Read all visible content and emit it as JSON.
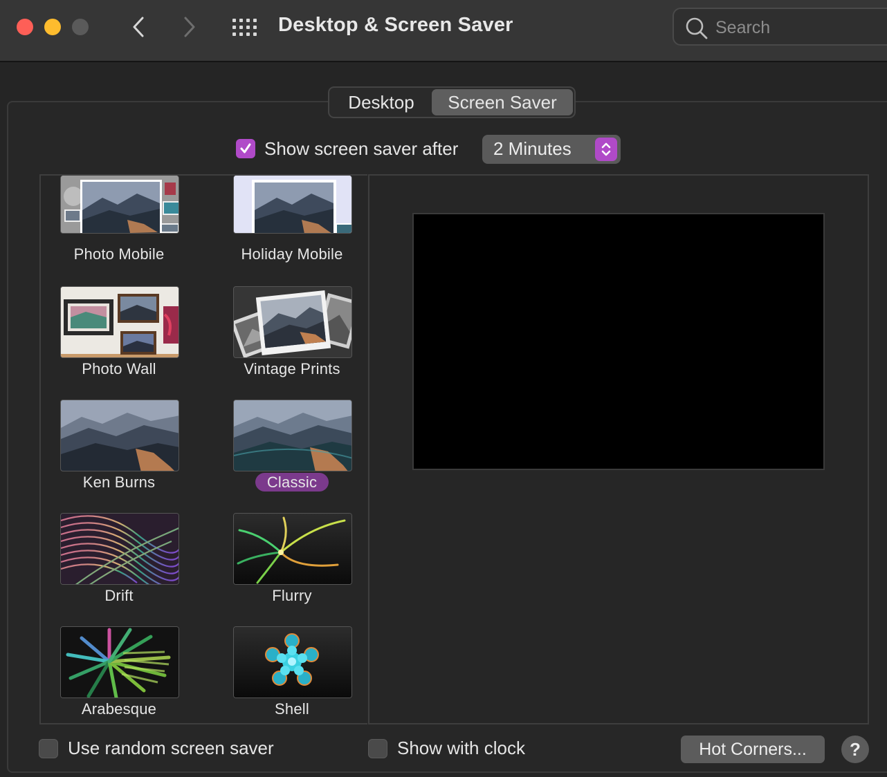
{
  "window": {
    "title": "Desktop & Screen Saver",
    "search_placeholder": "Search"
  },
  "tabs": [
    {
      "label": "Desktop",
      "active": false
    },
    {
      "label": "Screen Saver",
      "active": true
    }
  ],
  "show_after": {
    "label": "Show screen saver after",
    "checked": true,
    "value": "2 Minutes"
  },
  "savers": [
    {
      "name": "Photo Mobile",
      "selected": false
    },
    {
      "name": "Holiday Mobile",
      "selected": false
    },
    {
      "name": "Photo Wall",
      "selected": false
    },
    {
      "name": "Vintage Prints",
      "selected": false
    },
    {
      "name": "Ken Burns",
      "selected": false
    },
    {
      "name": "Classic",
      "selected": true
    },
    {
      "name": "Drift",
      "selected": false
    },
    {
      "name": "Flurry",
      "selected": false
    },
    {
      "name": "Arabesque",
      "selected": false
    },
    {
      "name": "Shell",
      "selected": false
    }
  ],
  "bottom": {
    "random_label": "Use random screen saver",
    "random_checked": false,
    "clock_label": "Show with clock",
    "clock_checked": false,
    "hot_corners_label": "Hot Corners...",
    "help_label": "?"
  },
  "colors": {
    "accent": "#b04ac8",
    "selection": "#7b3a8c"
  }
}
